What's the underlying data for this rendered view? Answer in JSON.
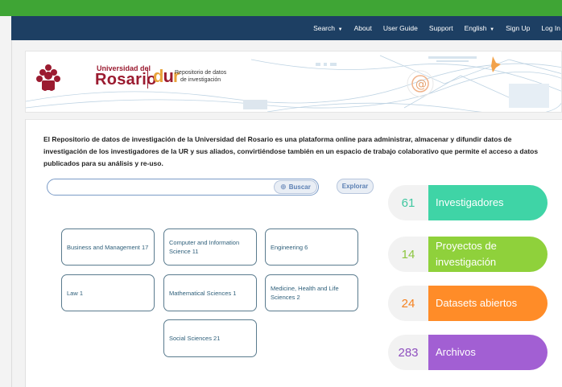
{
  "nav": {
    "search": "Search",
    "about": "About",
    "user_guide": "User Guide",
    "support": "Support",
    "language": "English",
    "sign_up": "Sign Up",
    "log_in": "Log In"
  },
  "banner": {
    "university_small": "Universidad del",
    "university_name": "Rosario",
    "repo_logo_d": "d",
    "repo_logo_u": "u",
    "repo_logo_r": "r",
    "repo_line1": "Repositorio de datos",
    "repo_line2": "de investigación"
  },
  "intro": "El Repositorio de datos de investigación de la Universidad del Rosario es una plataforma online para administrar, almacenar y difundir datos de investigación de los investigadores de la UR y sus aliados, convirtiéndose también en un espacio de trabajo colaborativo que permite el acceso a datos publicados para su análisis y re-uso.",
  "search": {
    "placeholder": "",
    "button": "Buscar",
    "explore": "Explorar"
  },
  "subjects": [
    {
      "label": "Business and Management 17"
    },
    {
      "label": "Computer and Information Science 11"
    },
    {
      "label": "Engineering 6"
    },
    {
      "label": "Law 1"
    },
    {
      "label": "Mathematical Sciences 1"
    },
    {
      "label": "Medicine, Health and Life Sciences 2"
    },
    {
      "label": "Social Sciences 21"
    }
  ],
  "stats": [
    {
      "count": "61",
      "label": "Investigadores",
      "color": "#3fd4a6",
      "num_color": "#3fc7a0"
    },
    {
      "count": "14",
      "label": "Proyectos de investigación",
      "color": "#8fd13b",
      "num_color": "#8cc63f"
    },
    {
      "count": "24",
      "label": "Datasets abiertos",
      "color": "#ff8c28",
      "num_color": "#f58220"
    },
    {
      "count": "283",
      "label": "Archivos",
      "color": "#a25fd3",
      "num_color": "#8e4fbf"
    }
  ],
  "colors": {
    "brand_green": "#3fa535",
    "nav_blue": "#1d3f63",
    "ur_red": "#9b1b30"
  }
}
